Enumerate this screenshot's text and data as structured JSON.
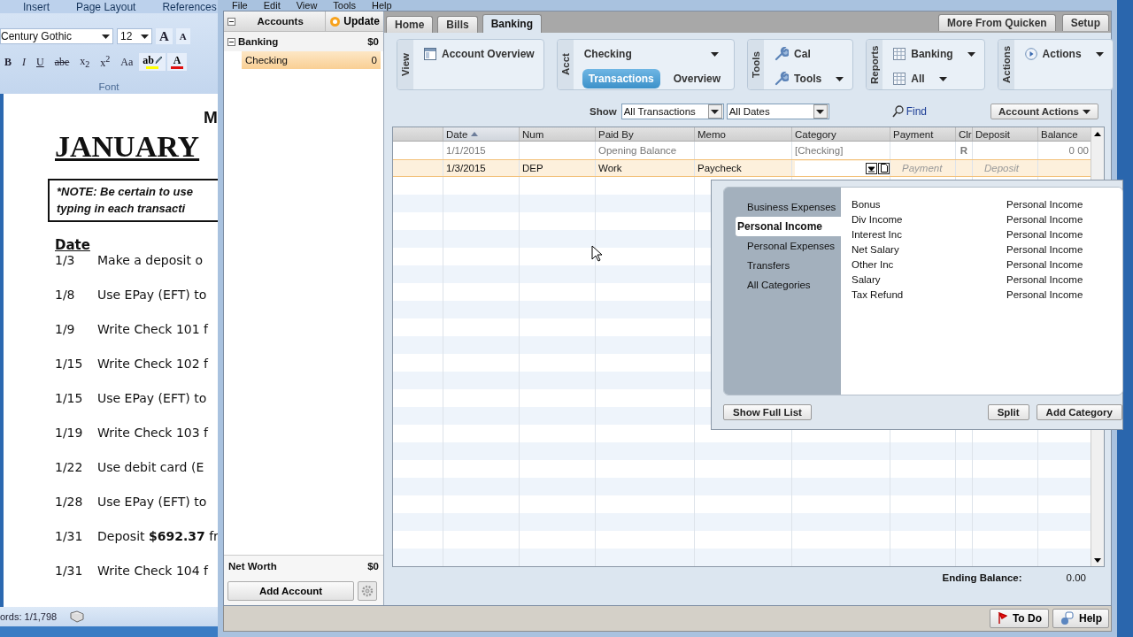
{
  "word": {
    "ribbon_tabs": [
      "Insert",
      "Page Layout",
      "References"
    ],
    "font_name": "Century Gothic",
    "font_size": "12",
    "size_buttons": [
      {
        "kind": "grow",
        "label": "A"
      },
      {
        "kind": "shrink",
        "label": "A"
      }
    ],
    "format_buttons": [
      {
        "kind": "bold",
        "label": "B"
      },
      {
        "kind": "italic",
        "label": "I"
      },
      {
        "kind": "underline",
        "label": "U"
      },
      {
        "kind": "strike",
        "label": "abe"
      },
      {
        "kind": "sub",
        "label": "x$_{2}$"
      },
      {
        "kind": "sup",
        "label": "x$^{2}$"
      },
      {
        "kind": "case",
        "label": "Aa"
      }
    ],
    "color_buttons": [
      {
        "kind": "highlight",
        "label": "ab",
        "color": "#ffff00"
      },
      {
        "kind": "font_color",
        "label": "A",
        "color": "#e01010"
      }
    ],
    "group_label": "Font",
    "document": {
      "heading_fragment": "M",
      "title": "JANUARY",
      "note_lines": [
        "*NOTE: Be certain to use",
        "typing in each transacti"
      ],
      "date_heading": "Date",
      "entries": [
        {
          "date": "1/3",
          "text": "Make a deposit o"
        },
        {
          "date": "1/8",
          "text": "Use EPay (EFT) to"
        },
        {
          "date": "1/9",
          "text": "Write Check 101 f"
        },
        {
          "date": "1/15",
          "text": "Write Check 102 f"
        },
        {
          "date": "1/15",
          "text": "Use EPay (EFT) to"
        },
        {
          "date": "1/19",
          "text": "Write Check 103 f"
        },
        {
          "date": "1/22",
          "text": "Use debit card (E"
        },
        {
          "date": "1/28",
          "text": "Use EPay (EFT) to"
        },
        {
          "date": "1/31",
          "text": "Deposit **$692.37** fr"
        },
        {
          "date": "1/31",
          "text": "Write Check 104 f"
        }
      ]
    },
    "status": "ords: 1/1,798"
  },
  "quicken": {
    "menu": [
      "File",
      "Edit",
      "View",
      "Tools",
      "Help"
    ],
    "sidebar": {
      "header": "Accounts",
      "update_button": "Update",
      "groups": [
        {
          "name": "Banking",
          "total": "$0",
          "expanded": true,
          "accounts": [
            {
              "name": "Checking",
              "balance": "0",
              "selected": true
            }
          ]
        }
      ],
      "net_worth_label": "Net Worth",
      "net_worth": "$0",
      "add_button": "Add Account"
    },
    "tabs": [
      {
        "label": "Home",
        "selected": false
      },
      {
        "label": "Bills",
        "selected": false
      },
      {
        "label": "Banking",
        "selected": true
      }
    ],
    "right_tabs": [
      "More From Quicken",
      "Setup"
    ],
    "toolbar": [
      {
        "title": "View",
        "rows": [
          [
            {
              "kind": "link",
              "label": "Account Overview"
            }
          ]
        ]
      },
      {
        "title": "Acct",
        "rows": [
          [
            {
              "kind": "menu",
              "label": "Checking"
            }
          ],
          [
            {
              "kind": "toggle",
              "label": "Transactions",
              "selected": true
            },
            {
              "kind": "toggle",
              "label": "Overview",
              "selected": false
            }
          ]
        ]
      },
      {
        "title": "Tools",
        "rows": [
          [
            {
              "kind": "link",
              "label": "Cal"
            }
          ],
          [
            {
              "kind": "menu",
              "label": "Tools"
            }
          ]
        ]
      },
      {
        "title": "Reports",
        "rows": [
          [
            {
              "kind": "menu",
              "label": "Banking"
            }
          ],
          [
            {
              "kind": "menu",
              "label": "All"
            }
          ]
        ]
      },
      {
        "title": "Actions",
        "rows": [
          [
            {
              "kind": "menu",
              "label": "Actions"
            }
          ]
        ]
      }
    ],
    "register": {
      "show_label": "Show",
      "filters": [
        "All Transactions",
        "All Dates"
      ],
      "find": "Find",
      "account_actions": "Account Actions",
      "columns": [
        {
          "label": "Date",
          "sorted": true
        },
        {
          "label": "Num",
          "sorted": false
        },
        {
          "label": "Paid By",
          "sorted": false
        },
        {
          "label": "Memo",
          "sorted": false
        },
        {
          "label": "Category",
          "sorted": false
        },
        {
          "label": "Payment",
          "sorted": false
        },
        {
          "label": "Clr",
          "sorted": false
        },
        {
          "label": "Deposit",
          "sorted": false
        },
        {
          "label": "Balance",
          "sorted": false
        }
      ],
      "rows": [
        {
          "kind": "posted",
          "selected": false,
          "date": "1/1/2015",
          "paid_by": "Opening Balance",
          "category": "[Checking]",
          "clr": "R",
          "balance": "0 00"
        },
        {
          "kind": "entry",
          "selected": true,
          "date": "1/3/2015",
          "num": "DEP",
          "paid_by": "Work",
          "memo": "Paycheck",
          "payment_placeholder": "Payment",
          "deposit_placeholder": "Deposit"
        }
      ],
      "ending_balance_label": "Ending Balance:",
      "ending_balance": "0.00"
    },
    "category_popup": {
      "groups": [
        {
          "label": "Business Expenses",
          "selected": false
        },
        {
          "label": "Personal Income",
          "selected": true
        },
        {
          "label": "Personal Expenses",
          "selected": false
        },
        {
          "label": "Transfers",
          "selected": false
        },
        {
          "label": "All Categories",
          "selected": false
        }
      ],
      "categories": [
        {
          "name": "Bonus",
          "type": "Personal Income"
        },
        {
          "name": "Div Income",
          "type": "Personal Income"
        },
        {
          "name": "Interest Inc",
          "type": "Personal Income"
        },
        {
          "name": "Net Salary",
          "type": "Personal Income"
        },
        {
          "name": "Other Inc",
          "type": "Personal Income"
        },
        {
          "name": "Salary",
          "type": "Personal Income"
        },
        {
          "name": "Tax Refund",
          "type": "Personal Income"
        }
      ],
      "left_buttons": [
        "Show Full List"
      ],
      "right_buttons": [
        "Split",
        "Add Category"
      ]
    },
    "status_buttons": [
      {
        "kind": "todo",
        "label": "To Do"
      },
      {
        "kind": "help",
        "label": "Help"
      }
    ]
  }
}
